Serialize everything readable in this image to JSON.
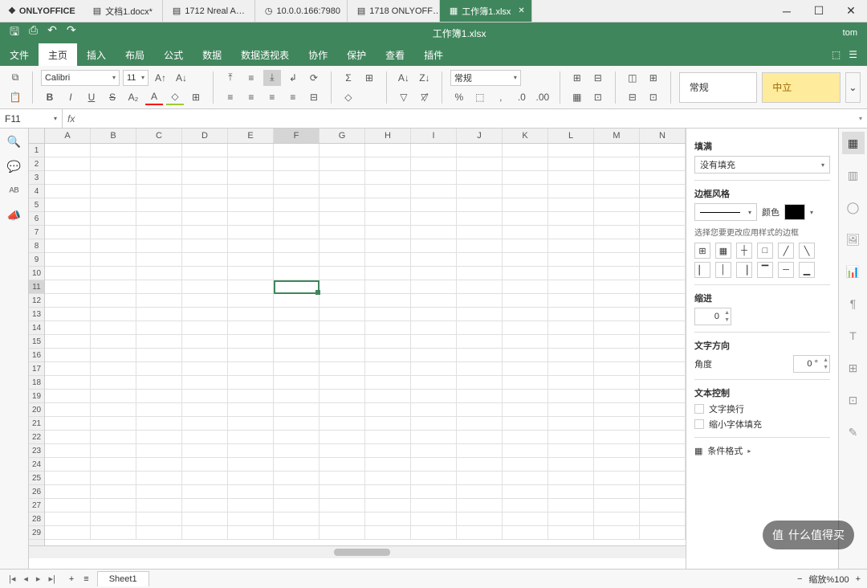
{
  "app": {
    "name": "ONLYOFFICE",
    "user": "tom"
  },
  "tabs": [
    {
      "label": "文档1.docx*",
      "icon": "doc"
    },
    {
      "label": "1712 Nreal A…",
      "icon": "doc"
    },
    {
      "label": "10.0.0.166:7980",
      "icon": "web"
    },
    {
      "label": "1718 ONLYOFF…",
      "icon": "doc"
    },
    {
      "label": "工作簿1.xlsx",
      "icon": "sheet",
      "active": true
    }
  ],
  "doc_title": "工作簿1.xlsx",
  "menu": {
    "items": [
      "文件",
      "主页",
      "插入",
      "布局",
      "公式",
      "数据",
      "数据透视表",
      "协作",
      "保护",
      "查看",
      "插件"
    ],
    "active": 1
  },
  "font": {
    "name": "Calibri",
    "size": "11"
  },
  "number_format": "常规",
  "styles": {
    "normal": "常规",
    "neutral": "中立"
  },
  "name_box": "F11",
  "fx_label": "fx",
  "columns": [
    "A",
    "B",
    "C",
    "D",
    "E",
    "F",
    "G",
    "H",
    "I",
    "J",
    "K",
    "L",
    "M",
    "N"
  ],
  "active_col_idx": 5,
  "rows": 29,
  "active_row": 11,
  "right_panel": {
    "fill_label": "填满",
    "fill_value": "没有填充",
    "border_style_label": "边框风格",
    "color_label": "颜色",
    "border_hint": "选择您要更改应用样式的边框",
    "indent_label": "缩进",
    "indent_value": "0",
    "text_dir_label": "文字方向",
    "angle_label": "角度",
    "angle_value": "0 °",
    "text_control_label": "文本控制",
    "wrap_label": "文字换行",
    "shrink_label": "缩小字体填充",
    "cond_format": "条件格式"
  },
  "sheet_tab": "Sheet1",
  "zoom": {
    "label": "缩放%",
    "value": "100"
  },
  "watermark": "什么值得买"
}
